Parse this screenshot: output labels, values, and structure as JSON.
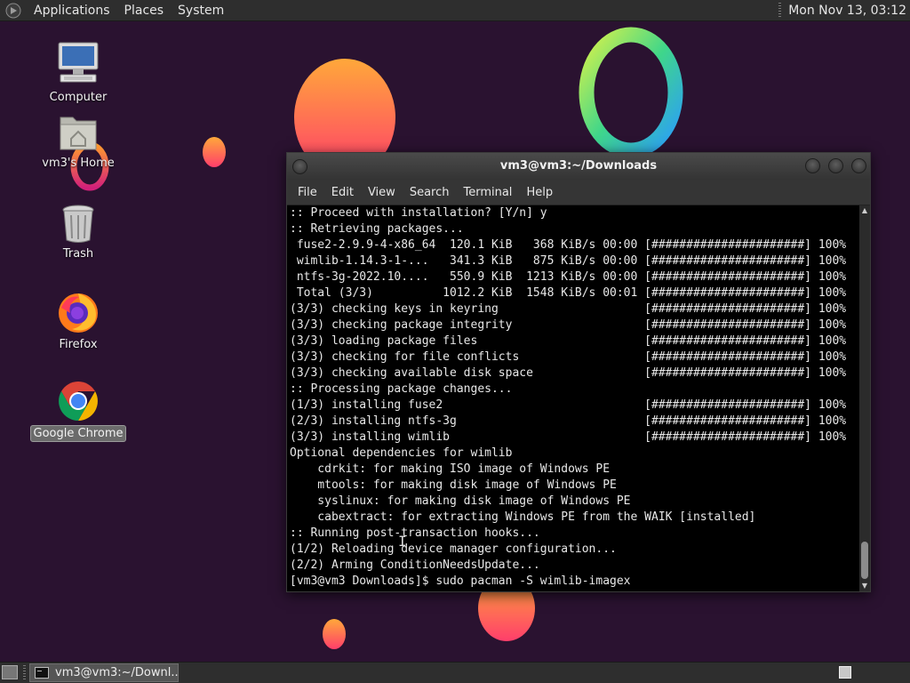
{
  "top_panel": {
    "menus": [
      "Applications",
      "Places",
      "System"
    ],
    "clock": "Mon Nov 13, 03:12"
  },
  "desktop": {
    "icons": [
      {
        "label": "Computer",
        "icon": "computer-icon"
      },
      {
        "label": "vm3's Home",
        "icon": "home-folder-icon"
      },
      {
        "label": "Trash",
        "icon": "trash-icon"
      },
      {
        "label": "Firefox",
        "icon": "firefox-icon"
      },
      {
        "label": "Google Chrome",
        "icon": "chrome-icon",
        "selected": true
      }
    ]
  },
  "terminal": {
    "title": "vm3@vm3:~/Downloads",
    "menus": [
      "File",
      "Edit",
      "View",
      "Search",
      "Terminal",
      "Help"
    ],
    "lines": [
      ":: Proceed with installation? [Y/n] y",
      ":: Retrieving packages...",
      " fuse2-2.9.9-4-x86_64  120.1 KiB   368 KiB/s 00:00 [######################] 100%",
      " wimlib-1.14.3-1-...   341.3 KiB   875 KiB/s 00:00 [######################] 100%",
      " ntfs-3g-2022.10....   550.9 KiB  1213 KiB/s 00:00 [######################] 100%",
      " Total (3/3)          1012.2 KiB  1548 KiB/s 00:01 [######################] 100%",
      "(3/3) checking keys in keyring                     [######################] 100%",
      "(3/3) checking package integrity                   [######################] 100%",
      "(3/3) loading package files                        [######################] 100%",
      "(3/3) checking for file conflicts                  [######################] 100%",
      "(3/3) checking available disk space                [######################] 100%",
      ":: Processing package changes...",
      "(1/3) installing fuse2                             [######################] 100%",
      "(2/3) installing ntfs-3g                           [######################] 100%",
      "(3/3) installing wimlib                            [######################] 100%",
      "Optional dependencies for wimlib",
      "    cdrkit: for making ISO image of Windows PE",
      "    mtools: for making disk image of Windows PE",
      "    syslinux: for making disk image of Windows PE",
      "    cabextract: for extracting Windows PE from the WAIK [installed]",
      ":: Running post-transaction hooks...",
      "(1/2) Reloading device manager configuration...",
      "(2/2) Arming ConditionNeedsUpdate...",
      "[vm3@vm3 Downloads]$ sudo pacman -S wimlib-imagex"
    ]
  },
  "taskbar": {
    "items": [
      {
        "label": "vm3@vm3:~/Downl...",
        "icon": "terminal-icon"
      }
    ]
  },
  "colors": {
    "wallpaper": "#2a1230",
    "panel": "#2e2e2e",
    "terminal_bg": "#000000",
    "terminal_fg": "#e8e8e8"
  }
}
